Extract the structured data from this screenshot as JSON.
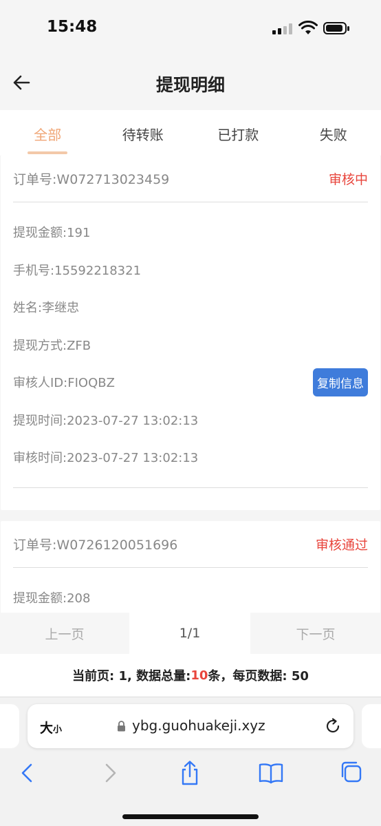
{
  "status_bar": {
    "time": "15:48"
  },
  "header": {
    "title": "提现明细"
  },
  "tabs": [
    {
      "label": "全部",
      "active": true
    },
    {
      "label": "待转账",
      "active": false
    },
    {
      "label": "已打款",
      "active": false
    },
    {
      "label": "失败",
      "active": false
    }
  ],
  "records": [
    {
      "order_no": "订单号:W072713023459",
      "status": "审核中",
      "fields": [
        "提现金额:191",
        "手机号:15592218321",
        "姓名:李继忠",
        "提现方式:ZFB",
        "审核人ID:FIOQBZ",
        "提现时间:2023-07-27 13:02:13",
        "审核时间:2023-07-27 13:02:13"
      ],
      "copy_button": "复制信息"
    },
    {
      "order_no": "订单号:W0726120051696",
      "status": "审核通过",
      "fields": [
        "提现金额:208"
      ]
    }
  ],
  "pagination": {
    "prev": "上一页",
    "page": "1/1",
    "next": "下一页"
  },
  "summary": {
    "prefix": "当前页: 1, 数据总量:",
    "total": "10",
    "suffix": "条，每页数据: 50"
  },
  "browser": {
    "text_size_big": "大",
    "text_size_small": "小",
    "url": "ybg.guohuakeji.xyz"
  },
  "colors": {
    "accent": "#f0a676",
    "status_red": "#e8453c",
    "button_blue": "#3f7cdb"
  }
}
